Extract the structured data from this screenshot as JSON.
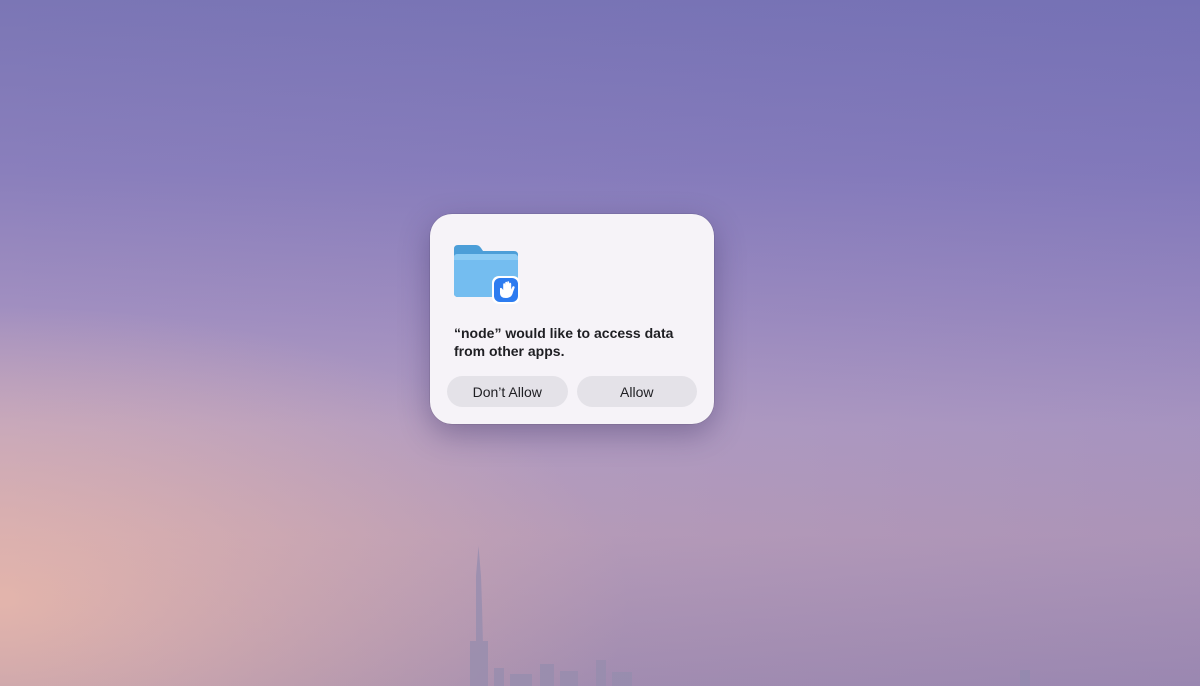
{
  "dialog": {
    "icon": "folder-with-hand-icon",
    "message": "“node” would like to access data from other apps.",
    "buttons": {
      "deny_label": "Don’t Allow",
      "allow_label": "Allow"
    }
  },
  "colors": {
    "dialog_background": "#f6f3f8",
    "button_background": "#e4e2e8",
    "folder_blue": "#6cb8ec",
    "badge_blue": "#2d7cf0"
  }
}
